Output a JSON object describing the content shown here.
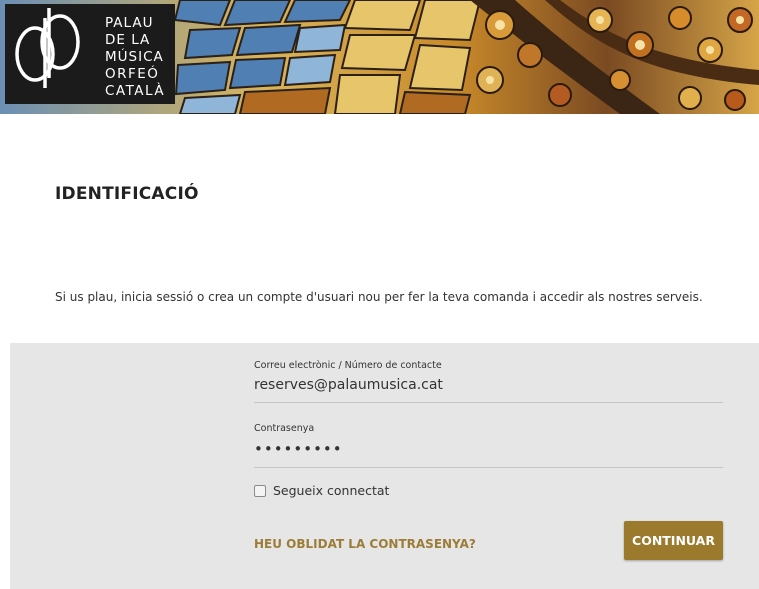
{
  "brand": {
    "logo_lines": [
      "PALAU",
      "DE LA",
      "MÚSICA",
      "ORFEÓ",
      "CATALÀ"
    ],
    "logo_name": "palau-musica-logo"
  },
  "page": {
    "title": "IDENTIFICACIÓ",
    "intro": "Si us plau, inicia sessió o crea un compte d'usuari nou per fer la teva comanda i accedir als nostres serveis."
  },
  "form": {
    "email_label": "Correu electrònic / Número de contacte",
    "email_value": "reserves@palaumusica.cat",
    "password_label": "Contrasenya",
    "password_value": "•••••••••",
    "remember_label": "Segueix connectat",
    "remember_checked": false,
    "forgot_label": "HEU OBLIDAT LA CONTRASENYA?",
    "submit_label": "CONTINUAR"
  },
  "colors": {
    "accent": "#9b7a2e",
    "link": "#9c7d38",
    "panel": "#e6e6e6"
  }
}
